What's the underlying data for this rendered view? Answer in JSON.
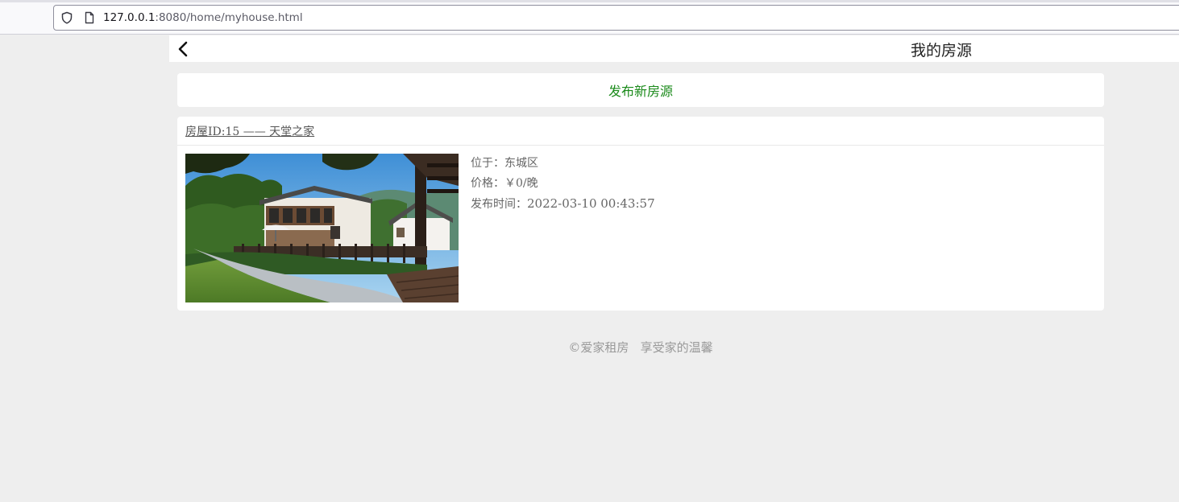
{
  "browser": {
    "url_host": "127.0.0.1",
    "url_rest": ":8080/home/myhouse.html"
  },
  "header": {
    "title": "我的房源"
  },
  "actions": {
    "publish_label": "发布新房源"
  },
  "houses": [
    {
      "title_link": "房屋ID:15 —— 天堂之家",
      "location_label": "位于：",
      "location": "东城区",
      "price_label": "价格：",
      "price": "￥0/晚",
      "time_label": "发布时间：",
      "time": "2022-03-10 00:43:57"
    }
  ],
  "footer": {
    "text": "©爱家租房   享受家的温馨"
  }
}
